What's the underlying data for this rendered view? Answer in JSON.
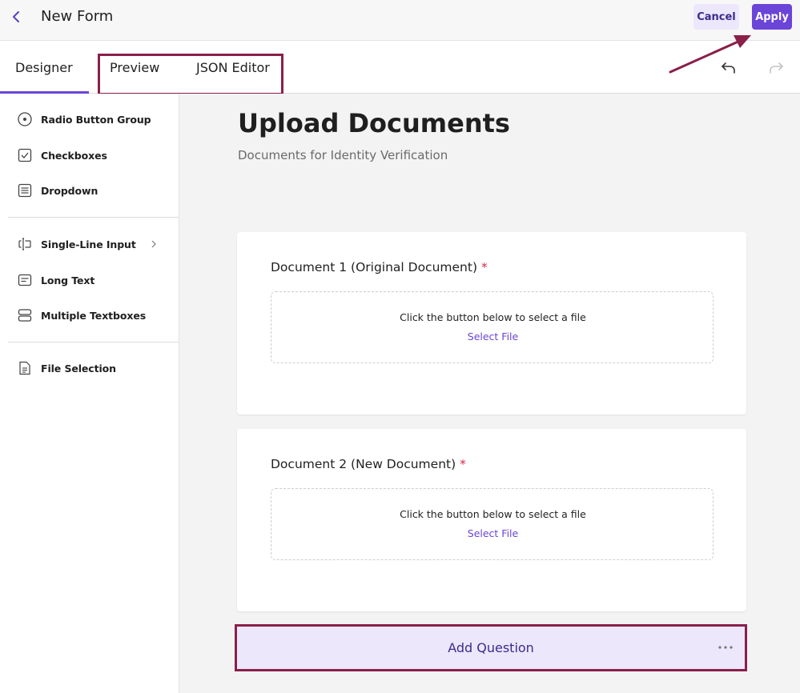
{
  "header": {
    "title": "New Form",
    "cancel_label": "Cancel",
    "apply_label": "Apply"
  },
  "tabs": [
    {
      "label": "Designer",
      "active": true
    },
    {
      "label": "Preview",
      "active": false
    },
    {
      "label": "JSON Editor",
      "active": false
    }
  ],
  "toolbar": {
    "undo_icon": "undo-icon",
    "redo_icon": "redo-icon"
  },
  "sidebar": {
    "items": [
      {
        "label": "Radio Button Group",
        "icon": "radio-button-icon"
      },
      {
        "label": "Checkboxes",
        "icon": "checkbox-icon"
      },
      {
        "label": "Dropdown",
        "icon": "dropdown-icon"
      },
      {
        "label": "Single-Line Input",
        "icon": "text-input-icon"
      },
      {
        "label": "Long Text",
        "icon": "long-text-icon"
      },
      {
        "label": "Multiple Textboxes",
        "icon": "multiple-textboxes-icon"
      },
      {
        "label": "File Selection",
        "icon": "file-icon"
      }
    ]
  },
  "survey": {
    "title": "Upload Documents",
    "description": "Documents for Identity Verification",
    "questions": [
      {
        "title": "Document 1 (Original Document)",
        "required_mark": "*",
        "drop_text": "Click the button below to select a file",
        "select_label": "Select File"
      },
      {
        "title": "Document 2 (New Document)",
        "required_mark": "*",
        "drop_text": "Click the button below to select a file",
        "select_label": "Select File"
      }
    ],
    "add_question_label": "Add Question"
  },
  "colors": {
    "accent": "#6b44d8",
    "annotation": "#8a1f4a",
    "required": "#d02a4a"
  }
}
